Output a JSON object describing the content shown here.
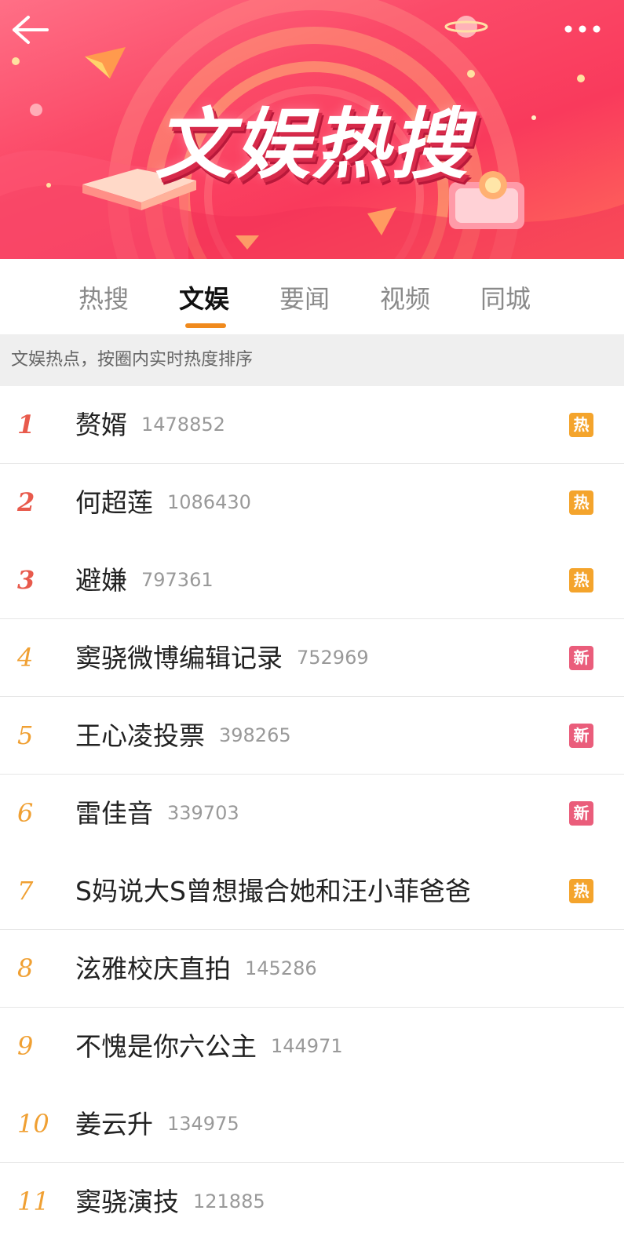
{
  "banner": {
    "title": "文娱热搜",
    "back_icon": "back-arrow-icon",
    "more_icon": "more-dots-icon"
  },
  "tabs": [
    {
      "label": "热搜",
      "active": false
    },
    {
      "label": "文娱",
      "active": true
    },
    {
      "label": "要闻",
      "active": false
    },
    {
      "label": "视频",
      "active": false
    },
    {
      "label": "同城",
      "active": false
    }
  ],
  "subheader": "文娱热点，按圈内实时热度排序",
  "colors": {
    "accent": "#f08a1d",
    "hot_badge": "#f4a42c",
    "new_badge": "#ea5d7b",
    "rank_top": "#e85a4c",
    "rank_rest": "#f0a033"
  },
  "items": [
    {
      "rank": "1",
      "title": "赘婿",
      "count": "1478852",
      "badge": "热"
    },
    {
      "rank": "2",
      "title": "何超莲",
      "count": "1086430",
      "badge": "热"
    },
    {
      "rank": "3",
      "title": "避嫌",
      "count": "797361",
      "badge": "热"
    },
    {
      "rank": "4",
      "title": "窦骁微博编辑记录",
      "count": "752969",
      "badge": "新"
    },
    {
      "rank": "5",
      "title": "王心凌投票",
      "count": "398265",
      "badge": "新"
    },
    {
      "rank": "6",
      "title": "雷佳音",
      "count": "339703",
      "badge": "新"
    },
    {
      "rank": "7",
      "title": "S妈说大S曾想撮合她和汪小菲爸爸",
      "count": "",
      "badge": "热"
    },
    {
      "rank": "8",
      "title": "泫雅校庆直拍",
      "count": "145286",
      "badge": ""
    },
    {
      "rank": "9",
      "title": "不愧是你六公主",
      "count": "144971",
      "badge": ""
    },
    {
      "rank": "10",
      "title": "姜云升",
      "count": "134975",
      "badge": ""
    },
    {
      "rank": "11",
      "title": "窦骁演技",
      "count": "121885",
      "badge": ""
    }
  ]
}
